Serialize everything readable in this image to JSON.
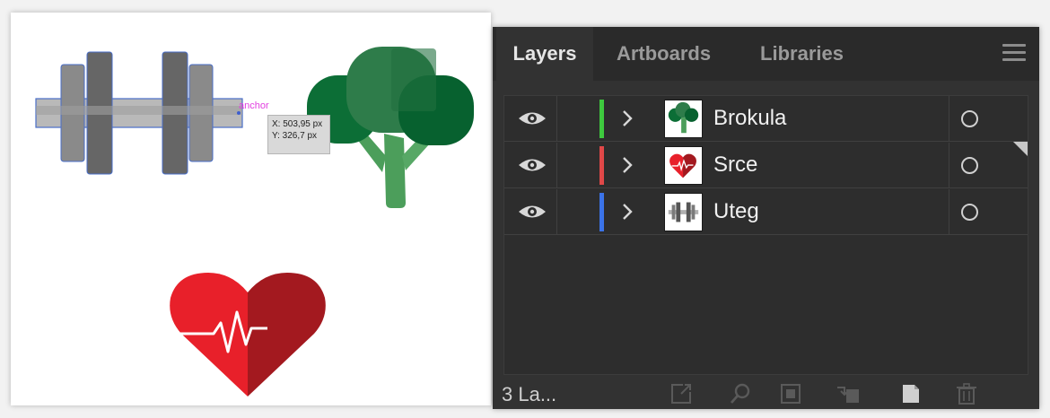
{
  "canvas": {
    "anchor_label": "anchor",
    "coord_x": "X: 503,95 px",
    "coord_y": "Y: 326,7 px"
  },
  "panel": {
    "tabs": [
      {
        "label": "Layers",
        "active": true
      },
      {
        "label": "Artboards",
        "active": false
      },
      {
        "label": "Libraries",
        "active": false
      }
    ],
    "layers": [
      {
        "name": "Brokula",
        "color": "#3ec93e",
        "thumb": "broccoli-icon"
      },
      {
        "name": "Srce",
        "color": "#e04848",
        "thumb": "heart-icon"
      },
      {
        "name": "Uteg",
        "color": "#3b73e8",
        "thumb": "dumbbell-icon"
      }
    ],
    "footer": {
      "layer_count": "3 La..."
    }
  },
  "colors": {
    "panel_bg": "#323232",
    "tab_bar_bg": "#2a2a2a",
    "broccoli_dark": "#0a6b38",
    "broccoli_mid": "#2f7d4b",
    "broccoli_stem": "#4ea05e",
    "heart_light": "#e8202a",
    "heart_dark": "#a3191f",
    "dumbbell_gray": "#6e6e6e"
  }
}
